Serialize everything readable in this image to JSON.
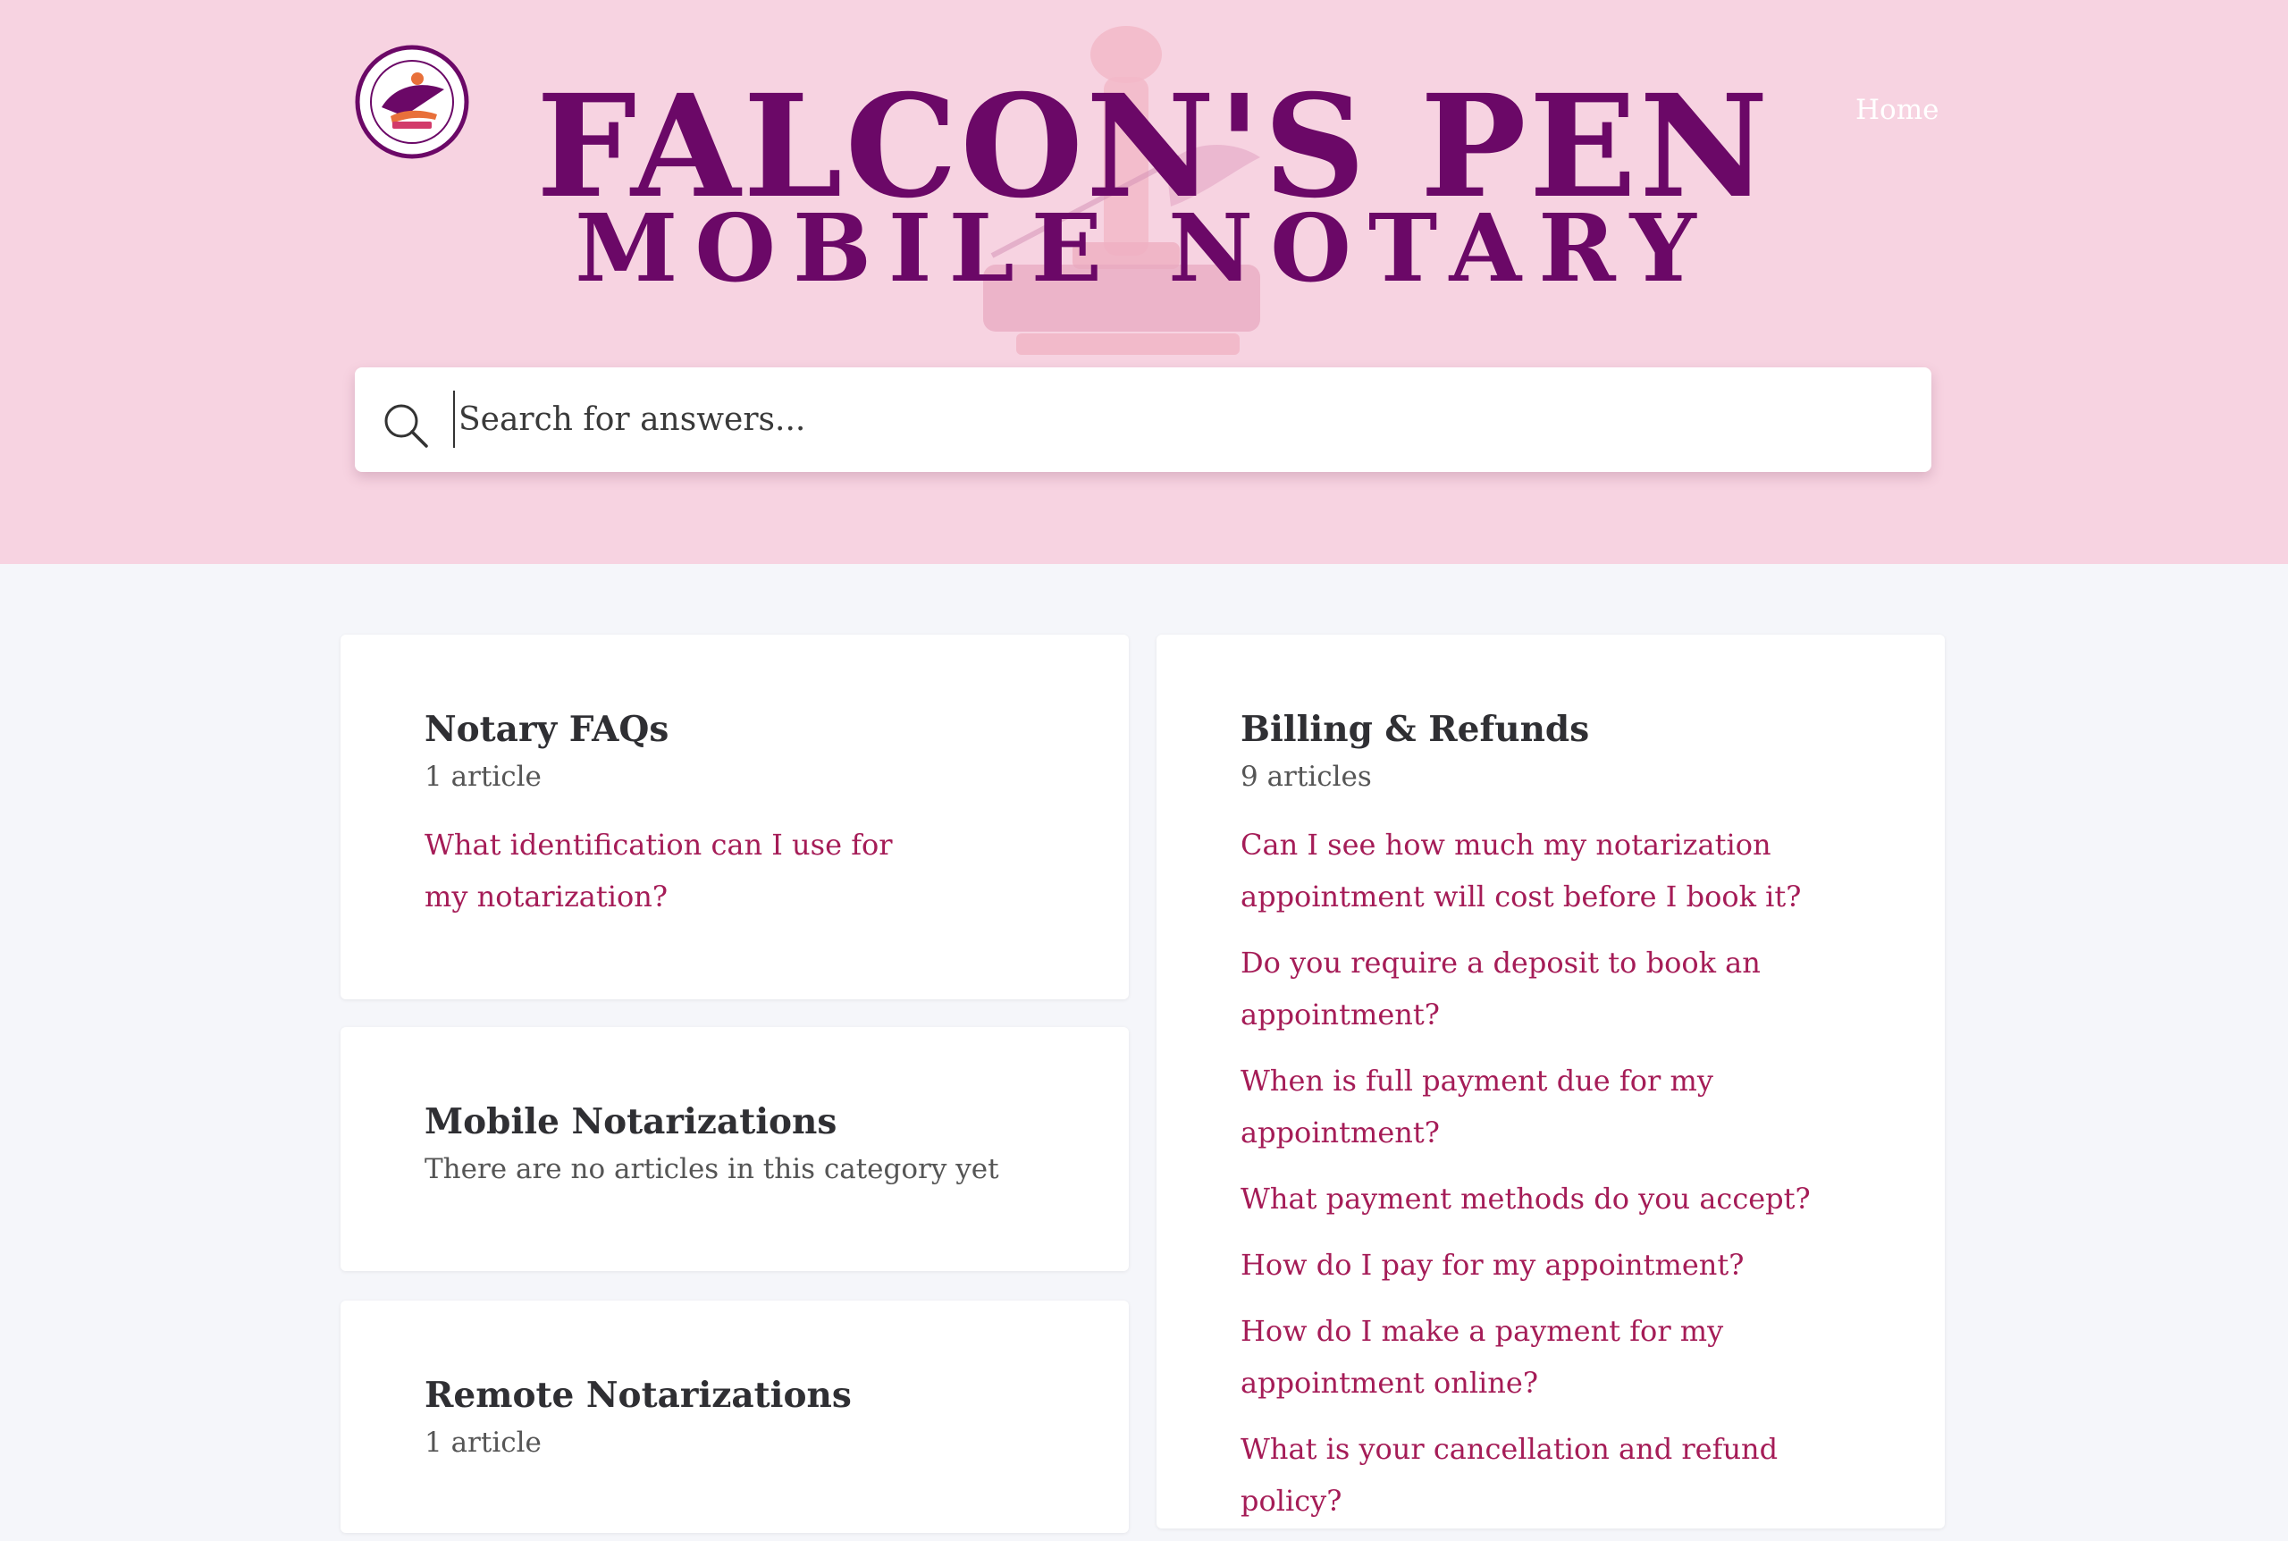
{
  "header": {
    "logo_text_top": "FALCON'S PEN",
    "logo_text_bottom": "MOBILE NOTARY",
    "brand_title": "FALCON'S PEN",
    "brand_subtitle": "MOBILE NOTARY",
    "nav": {
      "home_label": "Home"
    }
  },
  "search": {
    "placeholder": "Search for answers...",
    "icon": "search-icon"
  },
  "colors": {
    "hero_bg": "#f7d3e1",
    "brand": "#6b0867",
    "link": "#a51c57",
    "page_bg": "#f5f6fa"
  },
  "categories": [
    {
      "title": "Notary FAQs",
      "count": "1 article",
      "articles": [
        "What identification can I use for my notarization?"
      ]
    },
    {
      "title": "Mobile Notarizations",
      "count": "There are no articles in this category yet",
      "articles": []
    },
    {
      "title": "Remote Notarizations",
      "count": "1 article",
      "articles": []
    },
    {
      "title": "Billing & Refunds",
      "count": "9 articles",
      "articles": [
        "Can I see how much my notarization appointment will cost before I book it?",
        "Do you require a deposit to book an appointment?",
        "When is full payment due for my appointment?",
        "What payment methods do you accept?",
        "How do I pay for my appointment?",
        "How do I make a payment for my appointment online?",
        "What is your cancellation and refund policy?"
      ]
    }
  ]
}
